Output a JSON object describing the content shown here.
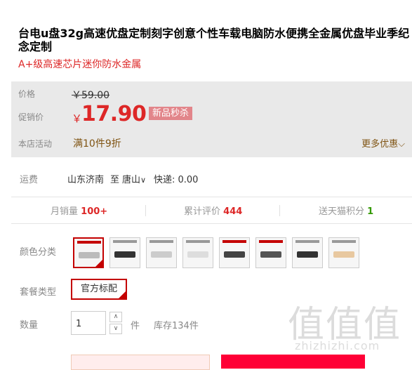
{
  "product": {
    "title": "台电u盘32g高速优盘定制刻字创意个性车载电脑防水便携全金属优盘毕业季纪念定制",
    "subtitle": "A+级高速芯片迷你防水金属"
  },
  "price": {
    "price_label": "价格",
    "original": "￥59.00",
    "promo_label": "促销价",
    "currency": "￥",
    "promo_value": "17.90",
    "badge": "新品秒杀",
    "activity_label": "本店活动",
    "activity": "满10件9折",
    "more": "更多优惠"
  },
  "shipping": {
    "label": "运费",
    "from": "山东济南",
    "to_word": "至",
    "to": "唐山",
    "express": "快递: 0.00"
  },
  "stats": {
    "monthly_label": "月销量",
    "monthly_value": "100+",
    "reviews_label": "累计评价",
    "reviews_value": "444",
    "points_label": "送天猫积分",
    "points_value": "1"
  },
  "options": {
    "color_label": "颜色分类",
    "package_label": "套餐类型",
    "package_value": "官方标配",
    "quantity_label": "数量",
    "quantity_value": "1",
    "quantity_unit": "件",
    "stock": "库存134件"
  },
  "watermark": {
    "big": "值值值",
    "site": "zhizhizhi.com"
  },
  "colors": {
    "accent": "#dd2727",
    "select": "#c40000",
    "buy": "#ff0036"
  }
}
